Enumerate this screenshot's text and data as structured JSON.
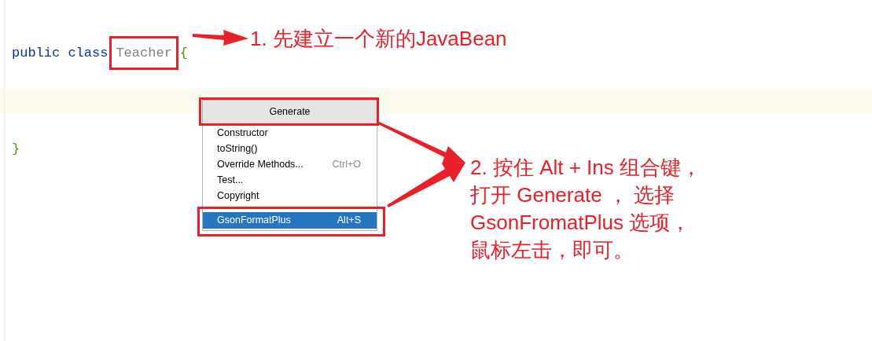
{
  "editor": {
    "lines": [
      {
        "current": false,
        "tokens": [
          {
            "kind": "keyword",
            "text": "public class",
            "framed": false
          },
          {
            "kind": "name",
            "text": "Teacher",
            "framed": true
          },
          {
            "kind": "brace",
            "text": "{",
            "framed": false
          }
        ]
      },
      {
        "current": false
      },
      {
        "current": true
      },
      {
        "current": false
      },
      {
        "current": false,
        "tokens": [
          {
            "kind": "brace",
            "text": "}",
            "framed": false
          }
        ]
      }
    ]
  },
  "popup_menu": {
    "title": "Generate",
    "title_framed": true,
    "items": [
      {
        "kind": "item",
        "label": "Constructor",
        "selected": false,
        "framed": false
      },
      {
        "kind": "item",
        "label": "toString()",
        "selected": false,
        "framed": false
      },
      {
        "kind": "item",
        "label": "Override Methods...",
        "shortcut": "Ctrl+O",
        "selected": false,
        "framed": false
      },
      {
        "kind": "item",
        "label": "Test...",
        "selected": false,
        "framed": false
      },
      {
        "kind": "item",
        "label": "Copyright",
        "selected": false,
        "framed": false
      },
      {
        "kind": "separator"
      },
      {
        "kind": "item",
        "label": "GsonFormatPlus",
        "shortcut": "Alt+S",
        "selected": true,
        "framed": true
      }
    ]
  },
  "annotations": [
    {
      "text": "1. 先建立一个新的JavaBean"
    },
    {
      "lines": [
        "2. 按住 Alt + Ins 组合键，",
        "打开 Generate ， 选择",
        "GsonFromatPlus 选项，",
        "鼠标左击，即可。"
      ]
    }
  ]
}
